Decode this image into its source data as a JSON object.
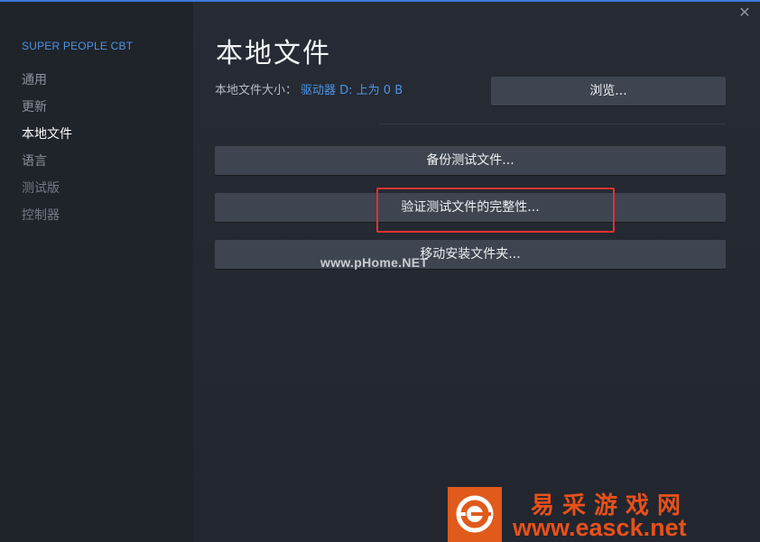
{
  "window": {
    "close_glyph": "✕"
  },
  "sidebar": {
    "app_name": "SUPER PEOPLE CBT",
    "items": [
      {
        "label": "通用"
      },
      {
        "label": "更新"
      },
      {
        "label": "本地文件",
        "active": true
      },
      {
        "label": "语言"
      },
      {
        "label": "测试版"
      },
      {
        "label": "控制器"
      }
    ]
  },
  "main": {
    "title": "本地文件",
    "size_label": "本地文件大小：",
    "size_value": "驱动器 D: 上为 0 B",
    "browse_label": "浏览...",
    "actions": {
      "backup": "备份测试文件...",
      "verify": "验证测试文件的完整性...",
      "move": "移动安装文件夹..."
    }
  },
  "overlay": {
    "watermark_text": "www.pHome.NET",
    "site_name_cn": "易采游戏网",
    "site_url": "www.easck.net"
  },
  "colors": {
    "accent": "#4c94e6",
    "highlight_box": "#e03131",
    "watermark_orange": "#e8501a"
  }
}
